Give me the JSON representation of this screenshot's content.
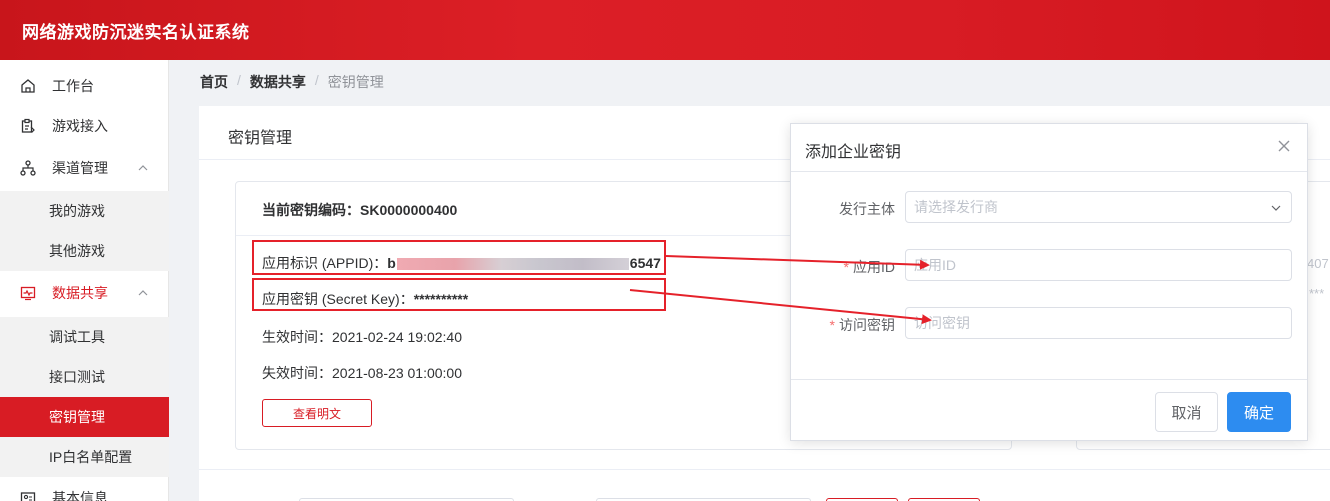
{
  "app": {
    "title": "网络游戏防沉迷实名认证系统"
  },
  "sidebar": {
    "items": [
      {
        "label": "工作台",
        "icon": "home-icon"
      },
      {
        "label": "游戏接入",
        "icon": "clipboard-icon"
      },
      {
        "label": "渠道管理",
        "icon": "sitemap-icon",
        "expanded": true,
        "children": [
          {
            "label": "我的游戏"
          },
          {
            "label": "其他游戏"
          }
        ]
      },
      {
        "label": "数据共享",
        "icon": "monitor-icon",
        "expanded": true,
        "active": true,
        "children": [
          {
            "label": "调试工具"
          },
          {
            "label": "接口测试"
          },
          {
            "label": "密钥管理",
            "active": true
          },
          {
            "label": "IP白名单配置"
          }
        ]
      },
      {
        "label": "基本信息",
        "icon": "id-card-icon"
      }
    ]
  },
  "breadcrumb": [
    "首页",
    "数据共享",
    "密钥管理"
  ],
  "panel": {
    "title": "密钥管理",
    "card": {
      "key_code_label": "当前密钥编码：",
      "key_code": "SK0000000400",
      "appid_label": "应用标识 (APPID)：",
      "appid_prefix": "b",
      "appid_suffix": "6547",
      "secret_label": "应用密钥 (Secret Key)：",
      "secret_value": "**********",
      "effective_label": "生效时间：",
      "effective_time": "2021-02-24 19:02:40",
      "expire_label": "失效时间：",
      "expire_time": "2021-08-23 01:00:00",
      "view_button": "查看明文"
    },
    "card2_ghost": {
      "line1": "407",
      "line2": "***"
    }
  },
  "dialog": {
    "title": "添加企业密钥",
    "fields": [
      {
        "label": "发行主体",
        "required": false,
        "placeholder": "请选择发行商"
      },
      {
        "label": "应用ID",
        "required": true,
        "placeholder": "应用ID"
      },
      {
        "label": "访问密钥",
        "required": true,
        "placeholder": "访问密钥"
      }
    ],
    "cancel_label": "取消",
    "confirm_label": "确定"
  },
  "colors": {
    "brand": "#d81c24",
    "primary": "#2d8cf0",
    "annotation": "#e5212a"
  }
}
